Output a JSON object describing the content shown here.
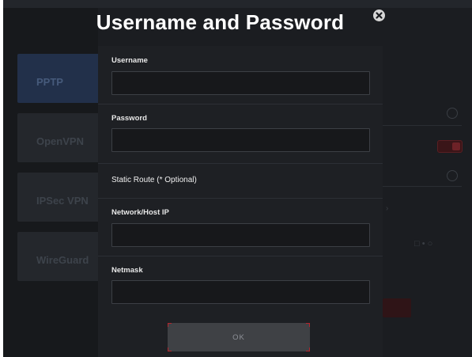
{
  "dialog": {
    "title": "Username and Password",
    "close_icon": "close-icon",
    "fields": {
      "username": {
        "label": "Username",
        "value": ""
      },
      "password": {
        "label": "Password",
        "value": ""
      },
      "network_host_ip": {
        "label": "Network/Host IP",
        "value": ""
      },
      "netmask": {
        "label": "Netmask",
        "value": ""
      }
    },
    "static_route_label": "Static Route (* Optional)",
    "ok_label": "OK"
  },
  "background_app": {
    "vpn_items": [
      {
        "name": "PPTP",
        "active": true
      },
      {
        "name": "OpenVPN",
        "active": false
      },
      {
        "name": "IPSec VPN",
        "active": false
      },
      {
        "name": "WireGuard",
        "active": false
      }
    ]
  },
  "colors": {
    "accent_red": "#b3262e",
    "overlay_bg": "#1b1d21",
    "panel_bg": "#1e2024",
    "title_text": "#ffffff"
  }
}
